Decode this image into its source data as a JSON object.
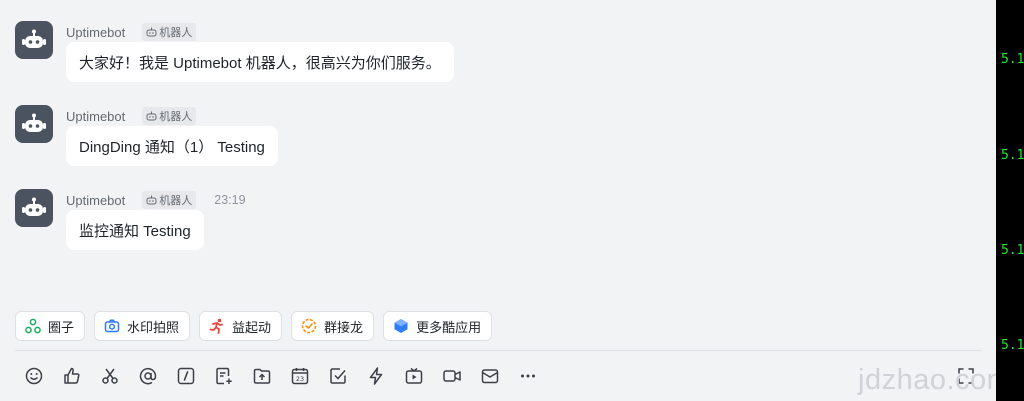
{
  "terminal": {
    "lines": [
      "5.1",
      "5.1",
      "5.1",
      "5.1"
    ]
  },
  "messages": [
    {
      "sender": "Uptimebot",
      "badge": "机器人",
      "time": "",
      "text": "大家好！我是 Uptimebot 机器人，很高兴为你们服务。"
    },
    {
      "sender": "Uptimebot",
      "badge": "机器人",
      "time": "",
      "text": "DingDing 通知（1） Testing"
    },
    {
      "sender": "Uptimebot",
      "badge": "机器人",
      "time": "23:19",
      "text": "监控通知 Testing"
    }
  ],
  "apps": [
    {
      "label": "圈子",
      "icon": "circle-group-icon",
      "color": "#1aad5e"
    },
    {
      "label": "水印拍照",
      "icon": "camera-icon",
      "color": "#2f7cf6"
    },
    {
      "label": "益起动",
      "icon": "running-person-icon",
      "color": "#e8453c"
    },
    {
      "label": "群接龙",
      "icon": "group-relay-icon",
      "color": "#ff8800"
    },
    {
      "label": "更多酷应用",
      "icon": "cool-apps-icon",
      "color": "#2f7cf6"
    }
  ],
  "toolbar": [
    "emoji-icon",
    "thumbs-up-icon",
    "scissors-icon",
    "mention-icon",
    "slash-command-icon",
    "document-add-icon",
    "folder-upload-icon",
    "calendar-icon",
    "task-check-icon",
    "lightning-icon",
    "live-tv-icon",
    "video-call-icon",
    "mail-icon",
    "more-icon",
    "expand-icon"
  ],
  "watermark": "jdzhao.com"
}
